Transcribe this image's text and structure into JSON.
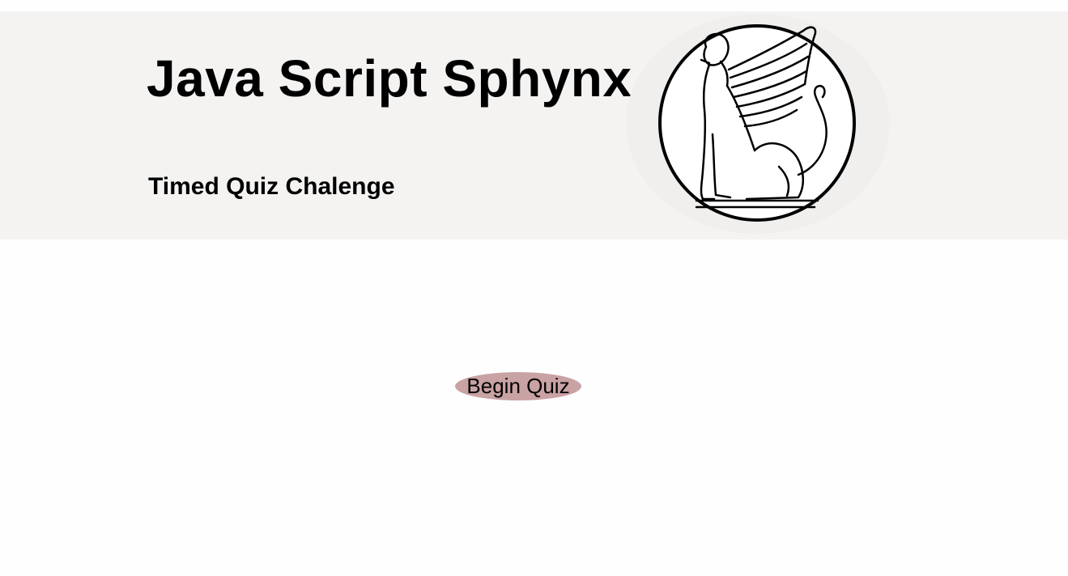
{
  "header": {
    "title": "Java Script Sphynx",
    "subtitle": "Timed Quiz Chalenge",
    "logo_icon": "sphinx-logo-icon"
  },
  "main": {
    "begin_button_label": "Begin Quiz"
  },
  "colors": {
    "header_background": "#f4f3f2",
    "button_background": "#c9a2a3",
    "page_background": "#fefefe"
  }
}
